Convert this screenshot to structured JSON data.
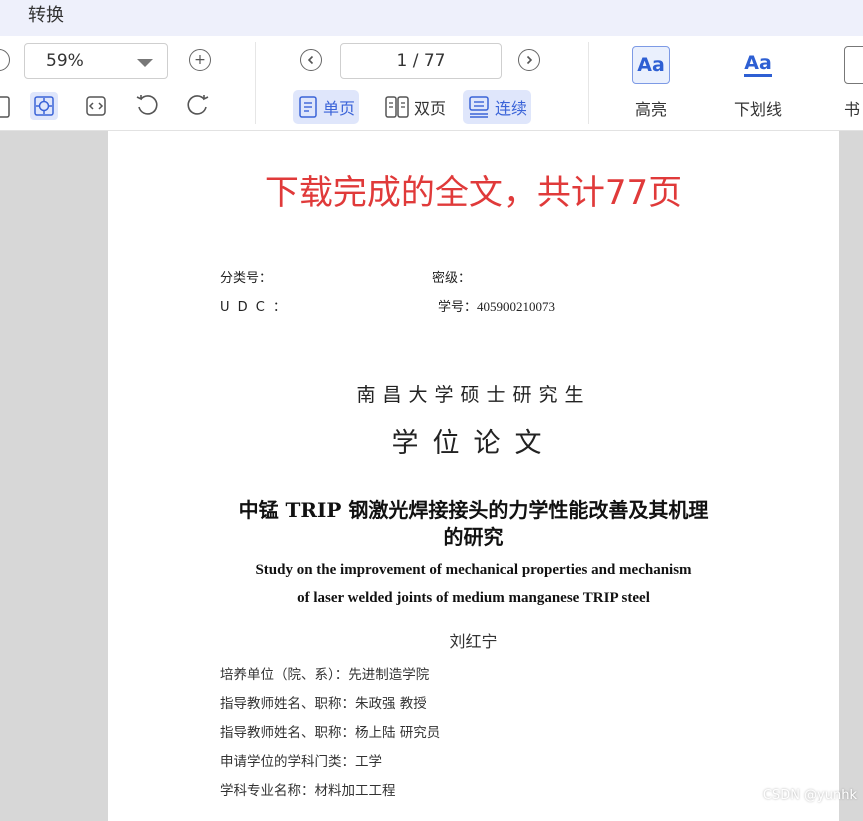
{
  "topbar": {
    "tab_label": "转换"
  },
  "toolbar": {
    "zoom_value": "59%",
    "page_indicator": "1 / 77",
    "zoom_in_symbol": "+",
    "view_modes": [
      {
        "label": "单页",
        "active": true
      },
      {
        "label": "双页",
        "active": false
      },
      {
        "label": "连续",
        "active": true
      }
    ],
    "annotations": [
      {
        "glyph": "Aa",
        "label": "高亮"
      },
      {
        "glyph": "Aa",
        "label": "下划线"
      },
      {
        "label": "书"
      }
    ]
  },
  "document": {
    "banner": "下载完成的全文，共计77页",
    "classification_label": "分类号：",
    "secret_label": "密级：",
    "udc_label": "U D C ：",
    "student_id_label": "学号：405900210073",
    "university_line": "南昌大学硕士研究生",
    "degree_line": "学位论文",
    "title_cn_line1": "中锰 TRIP 钢激光焊接接头的力学性能改善及其机理",
    "title_cn_line2": "的研究",
    "title_en_line1": "Study on the improvement of mechanical properties and mechanism",
    "title_en_line2": "of laser welded joints of medium manganese TRIP steel",
    "author": "刘红宁",
    "info_lines": [
      "培养单位（院、系）：先进制造学院",
      "指导教师姓名、职称：朱政强 教授",
      "指导教师姓名、职称：杨上陆 研究员",
      "申请学位的学科门类：工学",
      "学科专业名称：材料加工工程"
    ]
  },
  "watermark": "CSDN @yunhk",
  "colors": {
    "accent": "#3a63d8",
    "banner_red": "#e03a3a",
    "active_bg": "#dfe6fb"
  }
}
